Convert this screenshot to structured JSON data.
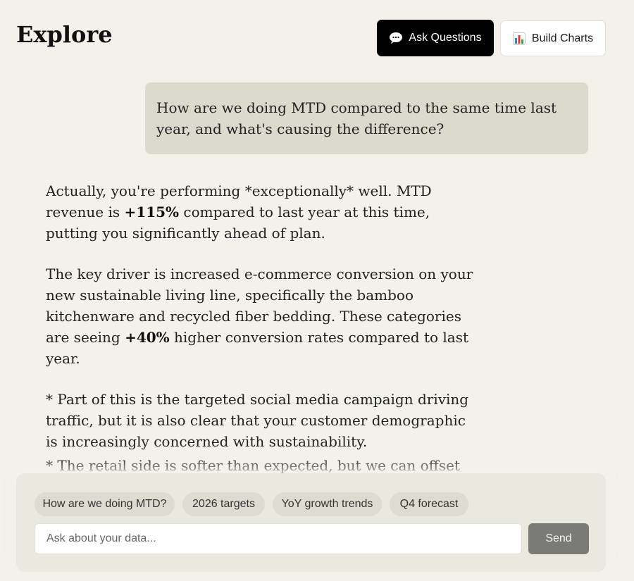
{
  "header": {
    "title": "Explore",
    "ask_label": "Ask Questions",
    "ask_icon": "speech-bubble-icon",
    "build_label": "Build Charts",
    "build_icon": "bar-chart-icon"
  },
  "conversation": {
    "user_message": "How are we doing MTD compared to the same time last year, and what's causing the difference?",
    "answer": {
      "p1_before": "Actually, you're performing *exceptionally* well. MTD revenue is ",
      "p1_bold": "+115%",
      "p1_after": " compared to last year at this time, putting you significantly ahead of plan.",
      "p2_before": "The key driver is increased e-commerce conversion on your new sustainable living line, specifically the bamboo kitchenware and recycled fiber bedding. These categories are seeing ",
      "p2_bold": "+40%",
      "p2_after": " higher conversion rates compared to last year.",
      "p3": "* Part of this is the targeted social media campaign driving traffic, but it is also clear that your customer demographic is increasingly concerned with sustainability.",
      "p4": "* The retail side is softer than expected, but we can offset this by"
    }
  },
  "composer": {
    "suggestions": [
      "How are we doing MTD?",
      "2026 targets",
      "YoY growth trends",
      "Q4 forecast"
    ],
    "input_placeholder": "Ask about your data...",
    "input_value": "",
    "send_label": "Send"
  },
  "colors": {
    "background": "#f3f1ea",
    "user_bubble": "#dcd9cd",
    "composer": "#ebe8df",
    "chip": "#dedbd1",
    "send_button": "#7a7a76",
    "ask_button": "#000000"
  }
}
